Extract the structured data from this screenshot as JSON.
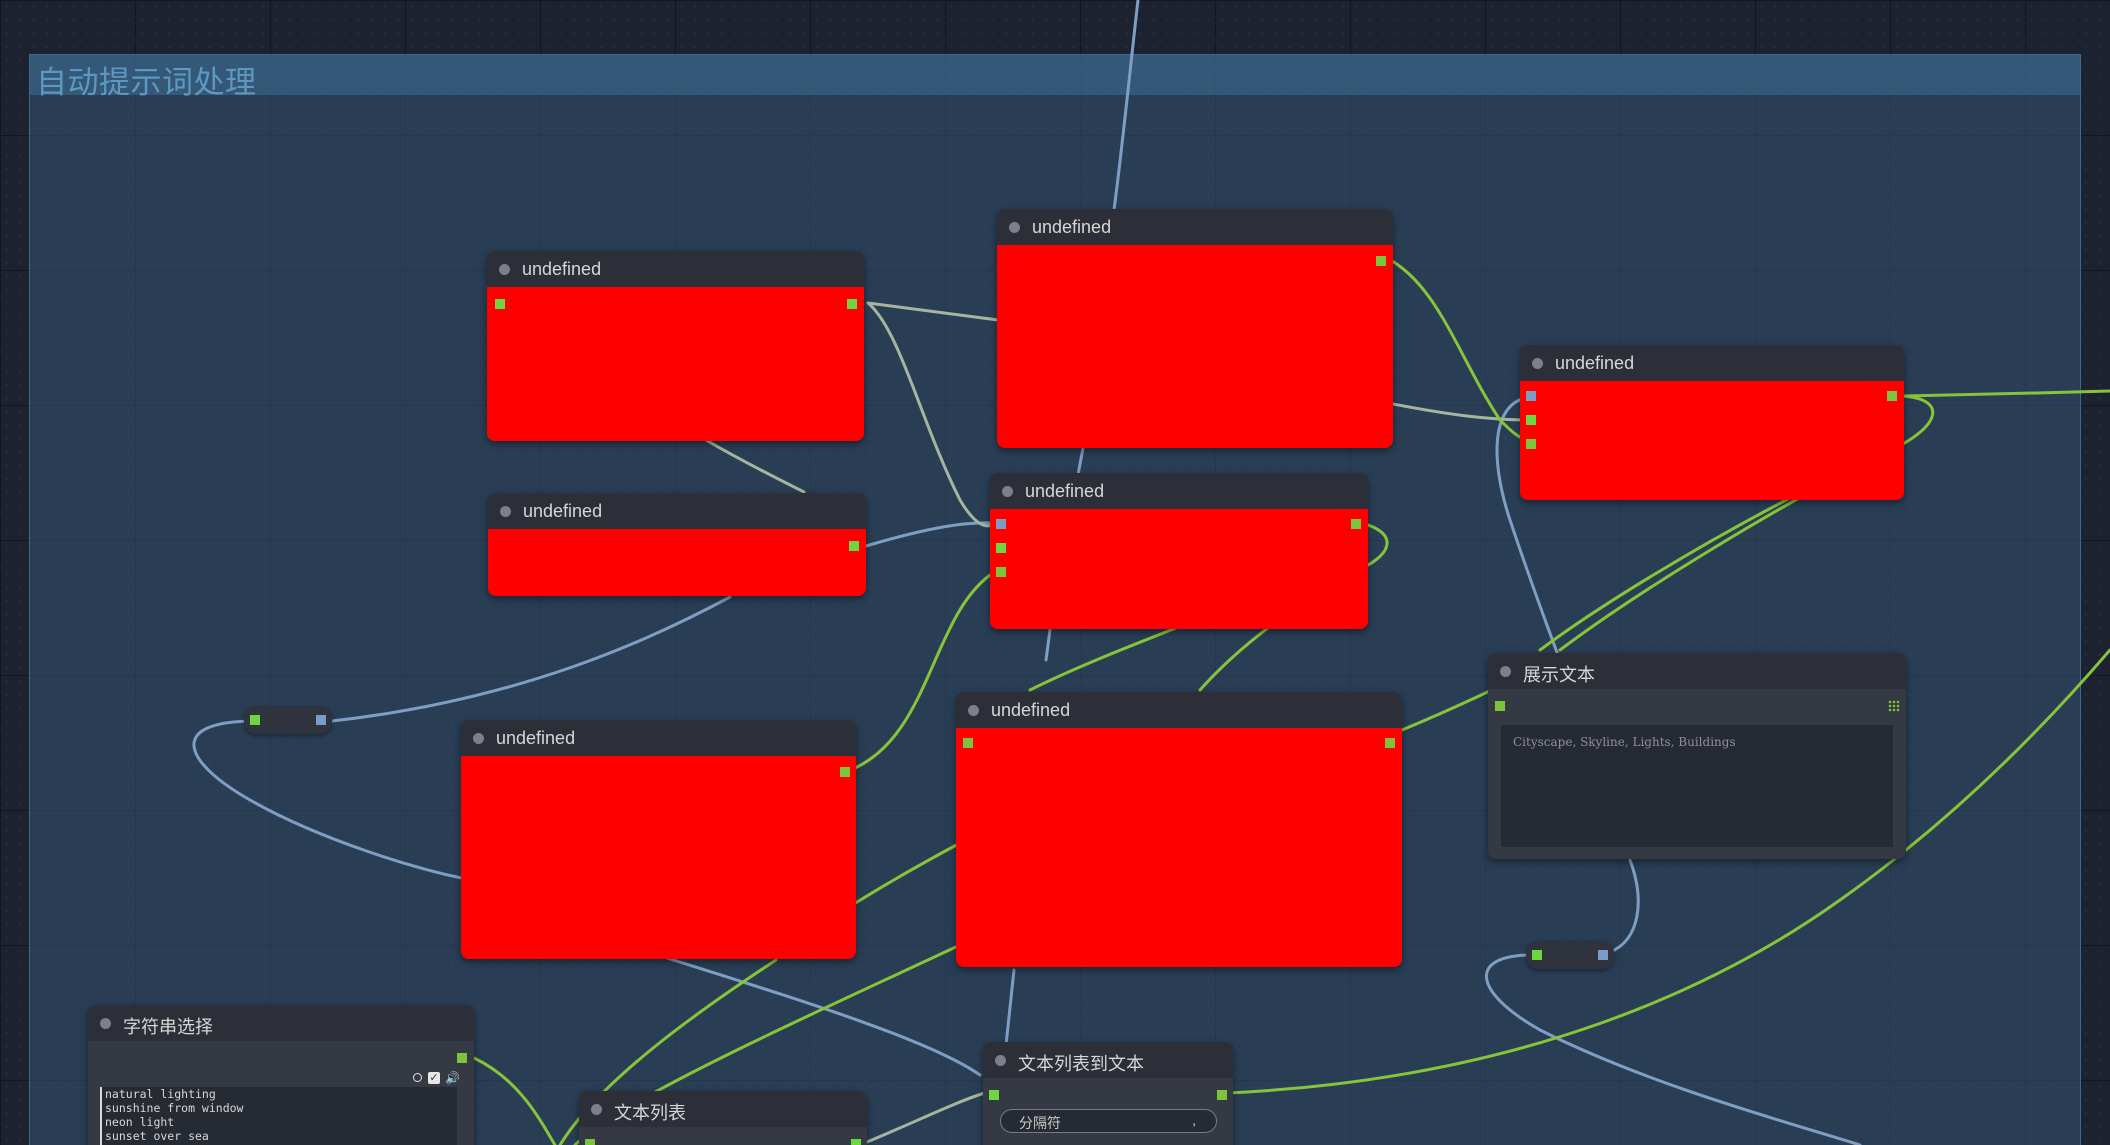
{
  "group": {
    "title": "自动提示词处理"
  },
  "nodes": {
    "undefined_a": {
      "title": "undefined"
    },
    "undefined_b": {
      "title": "undefined"
    },
    "undefined_c": {
      "title": "undefined"
    },
    "undefined_d": {
      "title": "undefined"
    },
    "undefined_e": {
      "title": "undefined"
    },
    "undefined_f": {
      "title": "undefined"
    },
    "undefined_g": {
      "title": "undefined"
    },
    "show_text": {
      "title": "展示文本",
      "text": "Cityscape, Skyline, Lights, Buildings"
    },
    "string_select": {
      "title": "字符串选择",
      "lines": [
        "natural lighting",
        "sunshine from window",
        "neon light",
        "sunset over sea"
      ]
    },
    "text_list": {
      "title": "文本列表"
    },
    "text_list_to_text": {
      "title": "文本列表到文本",
      "separator_label": "分隔符",
      "separator_value": ","
    }
  },
  "colors": {
    "link_blue": "#7f9ec4",
    "link_green": "#86c43a",
    "link_gray": "#a7b59f",
    "node_body_error": "#ff0000"
  }
}
